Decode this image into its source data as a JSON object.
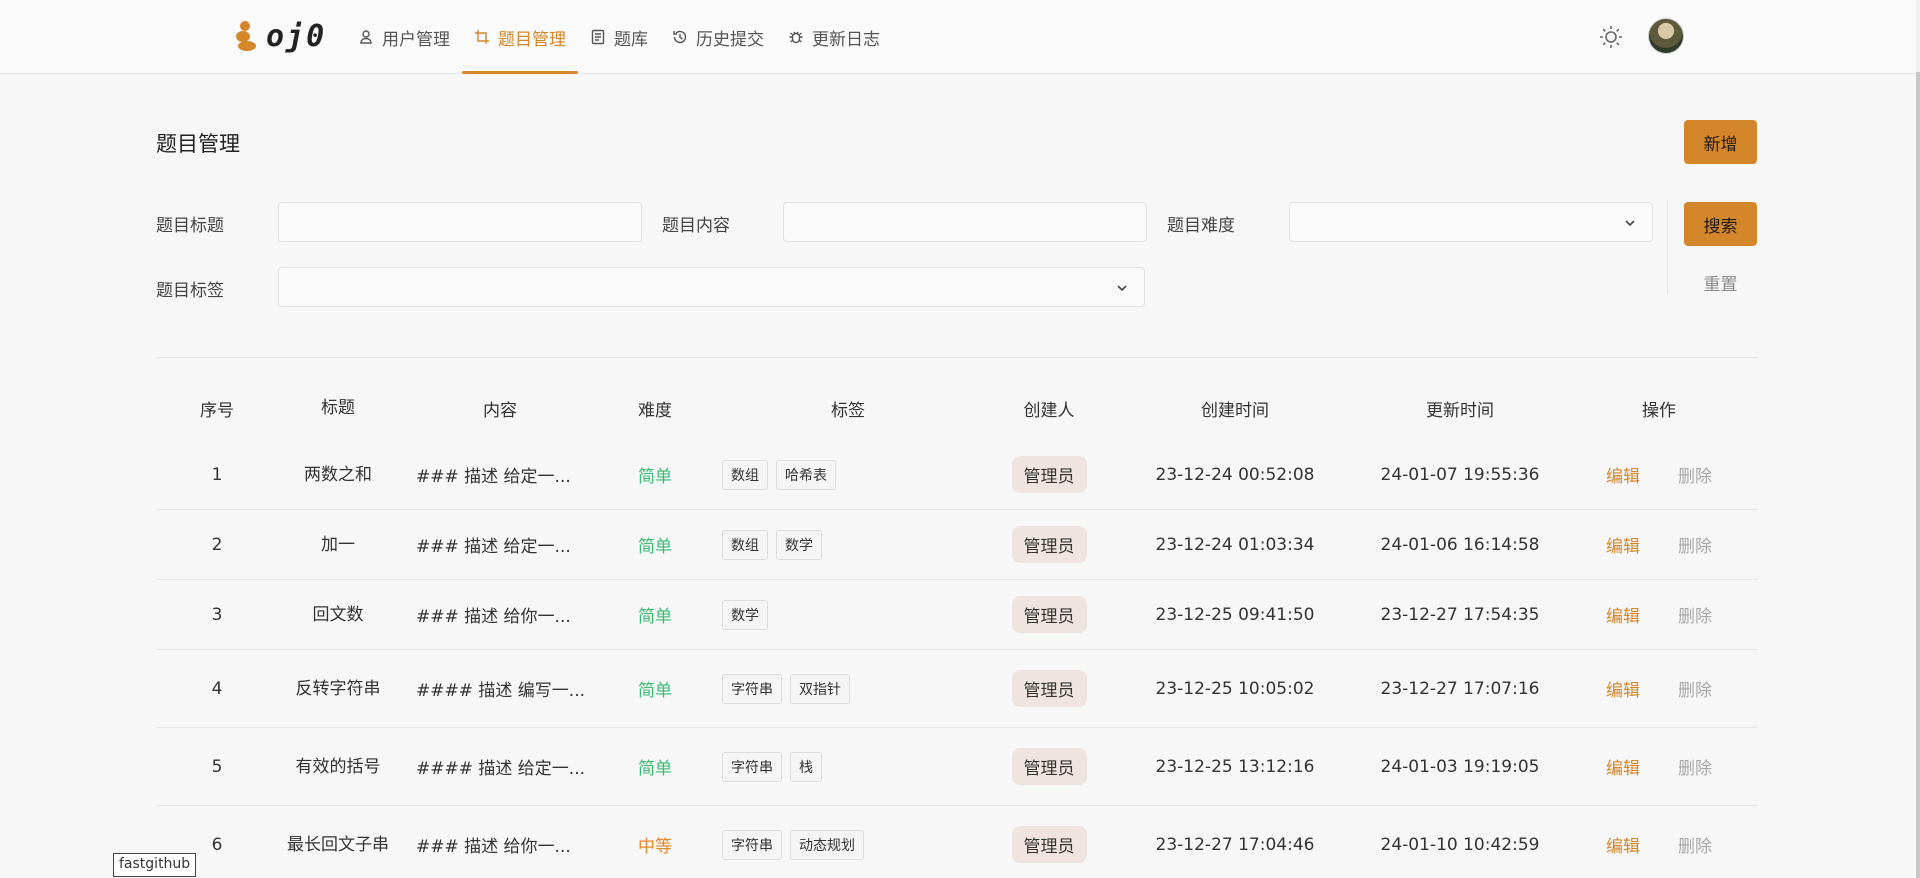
{
  "app": {
    "logo_text": "oj0"
  },
  "nav": {
    "items": [
      {
        "label": "用户管理",
        "icon": "user-icon"
      },
      {
        "label": "题目管理",
        "icon": "crop-icon"
      },
      {
        "label": "题库",
        "icon": "document-icon"
      },
      {
        "label": "历史提交",
        "icon": "history-icon"
      },
      {
        "label": "更新日志",
        "icon": "bug-icon"
      }
    ],
    "active_index": 1
  },
  "page": {
    "title": "题目管理",
    "add_label": "新增",
    "search_label": "搜索",
    "reset_label": "重置"
  },
  "filters": {
    "title_label": "题目标题",
    "content_label": "题目内容",
    "difficulty_label": "题目难度",
    "tags_label": "题目标签"
  },
  "table": {
    "headers": [
      "序号",
      "标题",
      "内容",
      "难度",
      "标签",
      "创建人",
      "创建时间",
      "更新时间",
      "操作"
    ],
    "rows": [
      {
        "idx": "1",
        "title": "两数之和",
        "content": "### 描述 给定一...",
        "difficulty": "简单",
        "tags": [
          "数组",
          "哈希表"
        ],
        "creator": "管理员",
        "created": "23-12-24 00:52:08",
        "updated": "24-01-07 19:55:36"
      },
      {
        "idx": "2",
        "title": "加一",
        "content": "### 描述 给定一...",
        "difficulty": "简单",
        "tags": [
          "数组",
          "数学"
        ],
        "creator": "管理员",
        "created": "23-12-24 01:03:34",
        "updated": "24-01-06 16:14:58"
      },
      {
        "idx": "3",
        "title": "回文数",
        "content": "### 描述 给你一...",
        "difficulty": "简单",
        "tags": [
          "数学"
        ],
        "creator": "管理员",
        "created": "23-12-25 09:41:50",
        "updated": "23-12-27 17:54:35"
      },
      {
        "idx": "4",
        "title": "反转字符串",
        "content": "#### 描述 编写一...",
        "difficulty": "简单",
        "tags": [
          "字符串",
          "双指针"
        ],
        "creator": "管理员",
        "created": "23-12-25 10:05:02",
        "updated": "23-12-27 17:07:16"
      },
      {
        "idx": "5",
        "title": "有效的括号",
        "content": "#### 描述 给定一...",
        "difficulty": "简单",
        "tags": [
          "字符串",
          "栈"
        ],
        "creator": "管理员",
        "created": "23-12-25 13:12:16",
        "updated": "24-01-03 19:19:05"
      },
      {
        "idx": "6",
        "title": "最长回文子串",
        "content": "### 描述 给你一...",
        "difficulty": "中等",
        "tags": [
          "字符串",
          "动态规划"
        ],
        "creator": "管理员",
        "created": "23-12-27 17:04:46",
        "updated": "24-01-10 10:42:59"
      }
    ],
    "edit_label": "编辑",
    "delete_label": "删除"
  },
  "floating_label": "fastgithub",
  "colors": {
    "accent": "#d4862a",
    "easy": "#3dbb74",
    "medium": "#e6862c"
  }
}
